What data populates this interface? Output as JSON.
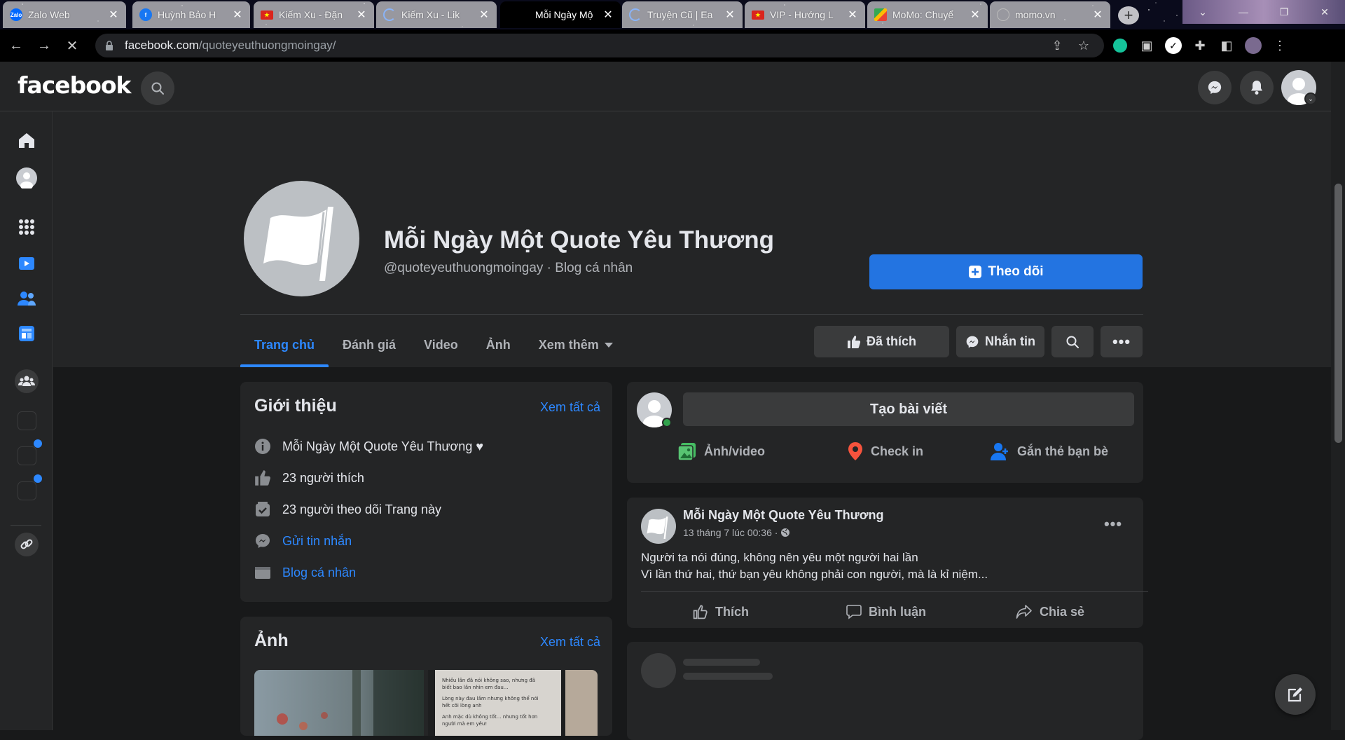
{
  "browser": {
    "tabs": [
      {
        "title": "Zalo Web",
        "favicon": "zalo-icon",
        "color": "#0068ff"
      },
      {
        "title": "Huỳnh Bảo H",
        "favicon": "facebook-icon",
        "color": "#1877f2"
      },
      {
        "title": "Kiếm Xu - Đặn",
        "favicon": "vietnam-flag-icon",
        "color": "#da251d"
      },
      {
        "title": "Kiếm Xu - Lik",
        "favicon": "loading-icon",
        "color": "#8ab4f8"
      },
      {
        "title": "Mỗi Ngày Mộ",
        "favicon": "none",
        "color": "#000000",
        "active": true
      },
      {
        "title": "Truyện Cũ | Ea",
        "favicon": "loading-icon",
        "color": "#8ab4f8"
      },
      {
        "title": "VIP - Hướng L",
        "favicon": "vietnam-flag-icon",
        "color": "#da251d"
      },
      {
        "title": "MoMo: Chuyể",
        "favicon": "play-store-icon",
        "color": "#34a853"
      },
      {
        "title": "momo.vn",
        "favicon": "globe-icon",
        "color": "#9aa0a6"
      }
    ],
    "url_host": "facebook.com",
    "url_path": "/quoteyeuthuongmoingay/"
  },
  "header": {
    "logo": "facebook",
    "icons": [
      "search-icon",
      "messenger-icon",
      "notifications-icon",
      "account-avatar"
    ]
  },
  "profile": {
    "name": "Mỗi Ngày Một Quote Yêu Thương",
    "subtitle": "@quoteyeuthuongmoingay · Blog cá nhân",
    "follow_label": "Theo dõi",
    "tabs": [
      {
        "label": "Trang chủ",
        "active": true
      },
      {
        "label": "Đánh giá"
      },
      {
        "label": "Video"
      },
      {
        "label": "Ảnh"
      },
      {
        "label": "Xem thêm",
        "dropdown": true
      }
    ],
    "liked_label": "Đã thích",
    "message_label": "Nhắn tin"
  },
  "intro": {
    "title": "Giới thiệu",
    "see_all": "Xem tất cả",
    "rows": [
      {
        "icon": "info-icon",
        "text": "Mỗi Ngày Một Quote Yêu Thương ♥"
      },
      {
        "icon": "like-icon",
        "text": "23 người thích"
      },
      {
        "icon": "follow-check-icon",
        "text": "23 người theo dõi Trang này"
      },
      {
        "icon": "messenger-icon",
        "text": "Gửi tin nhắn",
        "link": true
      },
      {
        "icon": "category-icon",
        "text": "Blog cá nhân",
        "link": true
      }
    ]
  },
  "photos": {
    "title": "Ảnh",
    "see_all": "Xem tất cả",
    "photo2_lines": [
      "Nhiều lần đã nói không sao, nhưng đã",
      "biết bao lần nhìn em đau...",
      "Lòng này đau lắm nhưng không thể nói",
      "hết cõi lòng anh",
      "Anh mặc dù không tốt... nhưng tốt hơn",
      "người mà em yêu!"
    ]
  },
  "create_post": {
    "button": "Tạo bài viết",
    "actions": [
      {
        "label": "Ảnh/video",
        "icon": "photo-video-icon",
        "color": "#45bd62"
      },
      {
        "label": "Check in",
        "icon": "location-pin-icon",
        "color": "#f5533d"
      },
      {
        "label": "Gắn thẻ bạn bè",
        "icon": "tag-friends-icon",
        "color": "#1877f2"
      }
    ]
  },
  "post": {
    "author": "Mỗi Ngày Một Quote Yêu Thương",
    "time": "13 tháng 7 lúc 00:36 ·",
    "lines": [
      "Người ta nói đúng, không nên yêu một người hai lần",
      "Vì lần thứ hai, thứ bạn yêu không phải con người, mà là kỉ niệm..."
    ],
    "actions": [
      "Thích",
      "Bình luận",
      "Chia sẻ"
    ]
  },
  "colors": {
    "accent": "#2d88ff",
    "primary_button": "#2374e1",
    "surface": "#242526",
    "background": "#18191a"
  }
}
